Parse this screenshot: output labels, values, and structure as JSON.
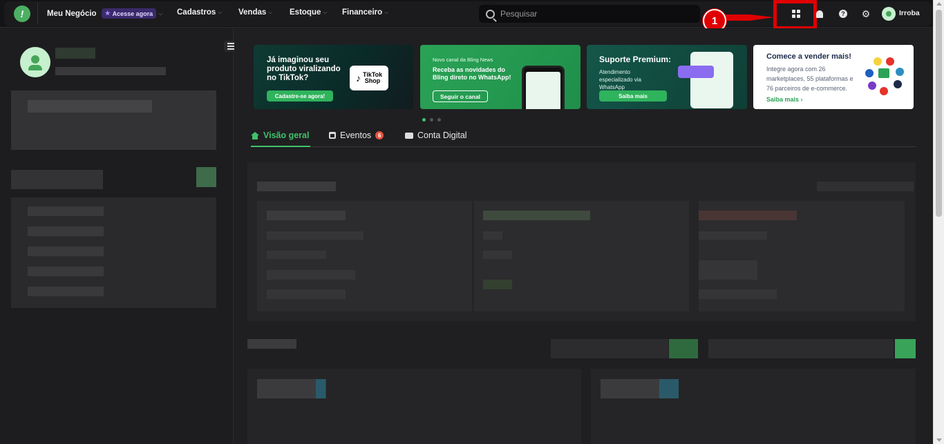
{
  "topbar": {
    "nav": [
      {
        "label": "Meu Negócio",
        "badge": "Acesse agora"
      },
      {
        "label": "Cadastros"
      },
      {
        "label": "Vendas"
      },
      {
        "label": "Estoque"
      },
      {
        "label": "Financeiro"
      }
    ],
    "search_placeholder": "Pesquisar",
    "user_name": "Irroba",
    "annotation_number": "1"
  },
  "banners": [
    {
      "title": "Já imaginou seu produto viralizando no TikTok?",
      "button": "Cadastre-se agora!",
      "badge": "TikTok Shop"
    },
    {
      "kicker": "Novo canal da Bling News",
      "title": "Receba as novidades do Bling direto no WhatsApp!",
      "button": "Seguir o canal"
    },
    {
      "title": "Suporte Premium:",
      "subtitle": "Atendimento especializado via WhatsApp",
      "button": "Saiba mais"
    },
    {
      "title": "Comece a vender mais!",
      "body": "Integre agora com 26 marketplaces, 55 plataformas e 76 parceiros de e-commerce.",
      "link": "Saiba mais"
    }
  ],
  "tabs": [
    {
      "label": "Visão geral",
      "active": true
    },
    {
      "label": "Eventos",
      "count": "6"
    },
    {
      "label": "Conta Digital"
    }
  ],
  "colors": {
    "accent": "#3fc26b",
    "annotation": "#e00000",
    "background": "#1f1f21"
  }
}
